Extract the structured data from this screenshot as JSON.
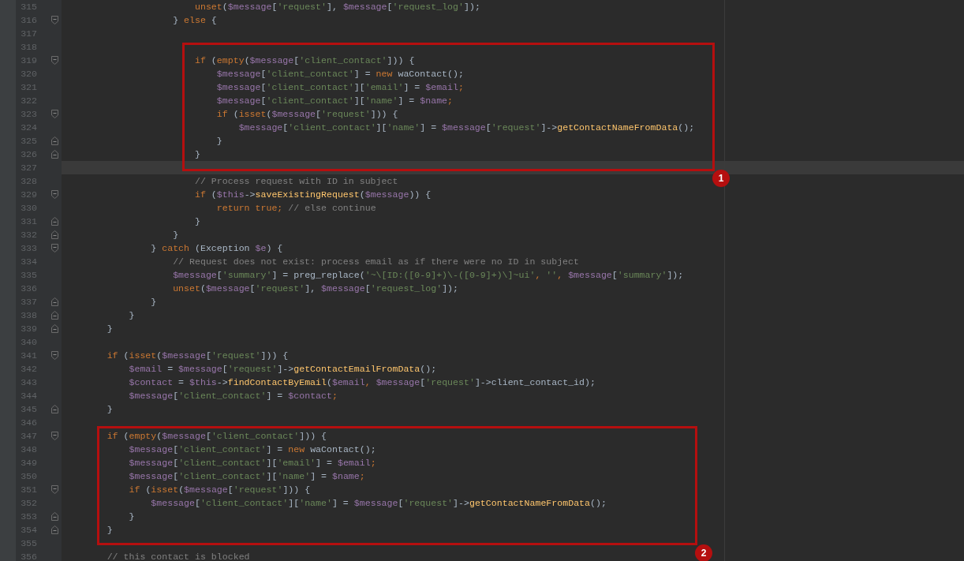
{
  "editor": {
    "lines": [
      {
        "number": "315",
        "fold_start": false,
        "fold_end": false,
        "current": false,
        "tokens": [
          {
            "text": "                        unset",
            "kind": "keyword"
          },
          {
            "text": "(",
            "kind": "plain"
          },
          {
            "text": "$message",
            "kind": "variable"
          },
          {
            "text": "[",
            "kind": "plain"
          },
          {
            "text": "'request'",
            "kind": "string"
          },
          {
            "text": "], ",
            "kind": "plain"
          },
          {
            "text": "$message",
            "kind": "variable"
          },
          {
            "text": "[",
            "kind": "plain"
          },
          {
            "text": "'request_log'",
            "kind": "string"
          },
          {
            "text": "]);",
            "kind": "plain"
          }
        ]
      },
      {
        "number": "316",
        "fold_start": true,
        "fold_end": false,
        "current": false,
        "tokens": [
          {
            "text": "                    } ",
            "kind": "plain"
          },
          {
            "text": "else",
            "kind": "keyword"
          },
          {
            "text": " {",
            "kind": "plain"
          }
        ]
      },
      {
        "number": "317",
        "fold_start": false,
        "fold_end": false,
        "current": false
      },
      {
        "number": "318",
        "fold_start": false,
        "fold_end": false,
        "current": false
      },
      {
        "number": "319",
        "fold_start": true,
        "fold_end": false,
        "current": false,
        "tokens": [
          {
            "text": "                        if ",
            "kind": "keyword"
          },
          {
            "text": "(",
            "kind": "plain"
          },
          {
            "text": "empty",
            "kind": "keyword"
          },
          {
            "text": "(",
            "kind": "plain"
          },
          {
            "text": "$message",
            "kind": "variable"
          },
          {
            "text": "[",
            "kind": "plain"
          },
          {
            "text": "'client_contact'",
            "kind": "string"
          },
          {
            "text": "])) {",
            "kind": "plain"
          }
        ]
      },
      {
        "number": "320",
        "fold_start": false,
        "fold_end": false,
        "current": false,
        "tokens": [
          {
            "text": "                            $message",
            "kind": "variable"
          },
          {
            "text": "[",
            "kind": "plain"
          },
          {
            "text": "'client_contact'",
            "kind": "string"
          },
          {
            "text": "] = ",
            "kind": "plain"
          },
          {
            "text": "new ",
            "kind": "keyword"
          },
          {
            "text": "waContact();",
            "kind": "plain"
          }
        ]
      },
      {
        "number": "321",
        "fold_start": false,
        "fold_end": false,
        "current": false,
        "tokens": [
          {
            "text": "                            $message",
            "kind": "variable"
          },
          {
            "text": "[",
            "kind": "plain"
          },
          {
            "text": "'client_contact'",
            "kind": "string"
          },
          {
            "text": "][",
            "kind": "plain"
          },
          {
            "text": "'email'",
            "kind": "string"
          },
          {
            "text": "] = ",
            "kind": "plain"
          },
          {
            "text": "$email",
            "kind": "variable"
          },
          {
            "text": ";",
            "kind": "keyword"
          }
        ]
      },
      {
        "number": "322",
        "fold_start": false,
        "fold_end": false,
        "current": false,
        "tokens": [
          {
            "text": "                            $message",
            "kind": "variable"
          },
          {
            "text": "[",
            "kind": "plain"
          },
          {
            "text": "'client_contact'",
            "kind": "string"
          },
          {
            "text": "][",
            "kind": "plain"
          },
          {
            "text": "'name'",
            "kind": "string"
          },
          {
            "text": "] = ",
            "kind": "plain"
          },
          {
            "text": "$name",
            "kind": "variable"
          },
          {
            "text": ";",
            "kind": "keyword"
          }
        ]
      },
      {
        "number": "323",
        "fold_start": true,
        "fold_end": false,
        "current": false,
        "tokens": [
          {
            "text": "                            if ",
            "kind": "keyword"
          },
          {
            "text": "(",
            "kind": "plain"
          },
          {
            "text": "isset",
            "kind": "keyword"
          },
          {
            "text": "(",
            "kind": "plain"
          },
          {
            "text": "$message",
            "kind": "variable"
          },
          {
            "text": "[",
            "kind": "plain"
          },
          {
            "text": "'request'",
            "kind": "string"
          },
          {
            "text": "])) {",
            "kind": "plain"
          }
        ]
      },
      {
        "number": "324",
        "fold_start": false,
        "fold_end": false,
        "current": false,
        "tokens": [
          {
            "text": "                                $message",
            "kind": "variable"
          },
          {
            "text": "[",
            "kind": "plain"
          },
          {
            "text": "'client_contact'",
            "kind": "string"
          },
          {
            "text": "][",
            "kind": "plain"
          },
          {
            "text": "'name'",
            "kind": "string"
          },
          {
            "text": "] = ",
            "kind": "plain"
          },
          {
            "text": "$message",
            "kind": "variable"
          },
          {
            "text": "[",
            "kind": "plain"
          },
          {
            "text": "'request'",
            "kind": "string"
          },
          {
            "text": "]->",
            "kind": "plain"
          },
          {
            "text": "getContactNameFromData",
            "kind": "function"
          },
          {
            "text": "();",
            "kind": "plain"
          }
        ]
      },
      {
        "number": "325",
        "fold_start": false,
        "fold_end": true,
        "current": false,
        "tokens": [
          {
            "text": "                            }",
            "kind": "plain"
          }
        ]
      },
      {
        "number": "326",
        "fold_start": false,
        "fold_end": true,
        "current": false,
        "tokens": [
          {
            "text": "                        }",
            "kind": "plain"
          }
        ]
      },
      {
        "number": "327",
        "fold_start": false,
        "fold_end": false,
        "current": true
      },
      {
        "number": "328",
        "fold_start": false,
        "fold_end": false,
        "current": false,
        "tokens": [
          {
            "text": "                        // Process request with ID in subject",
            "kind": "comment"
          }
        ]
      },
      {
        "number": "329",
        "fold_start": true,
        "fold_end": false,
        "current": false,
        "tokens": [
          {
            "text": "                        if ",
            "kind": "keyword"
          },
          {
            "text": "(",
            "kind": "plain"
          },
          {
            "text": "$this",
            "kind": "variable"
          },
          {
            "text": "->",
            "kind": "plain"
          },
          {
            "text": "saveExistingRequest",
            "kind": "function"
          },
          {
            "text": "(",
            "kind": "plain"
          },
          {
            "text": "$message",
            "kind": "variable"
          },
          {
            "text": ")) {",
            "kind": "plain"
          }
        ]
      },
      {
        "number": "330",
        "fold_start": false,
        "fold_end": false,
        "current": false,
        "tokens": [
          {
            "text": "                            return true; ",
            "kind": "keyword"
          },
          {
            "text": "// else continue",
            "kind": "comment"
          }
        ]
      },
      {
        "number": "331",
        "fold_start": false,
        "fold_end": true,
        "current": false,
        "tokens": [
          {
            "text": "                        }",
            "kind": "plain"
          }
        ]
      },
      {
        "number": "332",
        "fold_start": false,
        "fold_end": true,
        "current": false,
        "tokens": [
          {
            "text": "                    }",
            "kind": "plain"
          }
        ]
      },
      {
        "number": "333",
        "fold_start": true,
        "fold_end": false,
        "current": false,
        "tokens": [
          {
            "text": "                } ",
            "kind": "plain"
          },
          {
            "text": "catch ",
            "kind": "keyword"
          },
          {
            "text": "(Exception ",
            "kind": "plain"
          },
          {
            "text": "$e",
            "kind": "variable"
          },
          {
            "text": ") {",
            "kind": "plain"
          }
        ]
      },
      {
        "number": "334",
        "fold_start": false,
        "fold_end": false,
        "current": false,
        "tokens": [
          {
            "text": "                    // Request does not exist: process email as if there were no ID in subject",
            "kind": "comment"
          }
        ]
      },
      {
        "number": "335",
        "fold_start": false,
        "fold_end": false,
        "current": false,
        "tokens": [
          {
            "text": "                    $message",
            "kind": "variable"
          },
          {
            "text": "[",
            "kind": "plain"
          },
          {
            "text": "'summary'",
            "kind": "string"
          },
          {
            "text": "] = preg_replace(",
            "kind": "plain"
          },
          {
            "text": "'~\\[ID:([0-9]+)\\-([0-9]+)\\]~ui'",
            "kind": "string"
          },
          {
            "text": ", ",
            "kind": "keyword"
          },
          {
            "text": "''",
            "kind": "string"
          },
          {
            "text": ", ",
            "kind": "keyword"
          },
          {
            "text": "$message",
            "kind": "variable"
          },
          {
            "text": "[",
            "kind": "plain"
          },
          {
            "text": "'summary'",
            "kind": "string"
          },
          {
            "text": "]);",
            "kind": "plain"
          }
        ]
      },
      {
        "number": "336",
        "fold_start": false,
        "fold_end": false,
        "current": false,
        "tokens": [
          {
            "text": "                    unset",
            "kind": "keyword"
          },
          {
            "text": "(",
            "kind": "plain"
          },
          {
            "text": "$message",
            "kind": "variable"
          },
          {
            "text": "[",
            "kind": "plain"
          },
          {
            "text": "'request'",
            "kind": "string"
          },
          {
            "text": "], ",
            "kind": "plain"
          },
          {
            "text": "$message",
            "kind": "variable"
          },
          {
            "text": "[",
            "kind": "plain"
          },
          {
            "text": "'request_log'",
            "kind": "string"
          },
          {
            "text": "]);",
            "kind": "plain"
          }
        ]
      },
      {
        "number": "337",
        "fold_start": false,
        "fold_end": true,
        "current": false,
        "tokens": [
          {
            "text": "                }",
            "kind": "plain"
          }
        ]
      },
      {
        "number": "338",
        "fold_start": false,
        "fold_end": true,
        "current": false,
        "tokens": [
          {
            "text": "            }",
            "kind": "plain"
          }
        ]
      },
      {
        "number": "339",
        "fold_start": false,
        "fold_end": true,
        "current": false,
        "tokens": [
          {
            "text": "        }",
            "kind": "plain"
          }
        ]
      },
      {
        "number": "340",
        "fold_start": false,
        "fold_end": false,
        "current": false
      },
      {
        "number": "341",
        "fold_start": true,
        "fold_end": false,
        "current": false,
        "tokens": [
          {
            "text": "        if ",
            "kind": "keyword"
          },
          {
            "text": "(",
            "kind": "plain"
          },
          {
            "text": "isset",
            "kind": "keyword"
          },
          {
            "text": "(",
            "kind": "plain"
          },
          {
            "text": "$message",
            "kind": "variable"
          },
          {
            "text": "[",
            "kind": "plain"
          },
          {
            "text": "'request'",
            "kind": "string"
          },
          {
            "text": "])) {",
            "kind": "plain"
          }
        ]
      },
      {
        "number": "342",
        "fold_start": false,
        "fold_end": false,
        "current": false,
        "tokens": [
          {
            "text": "            $email",
            "kind": "variable"
          },
          {
            "text": " = ",
            "kind": "plain"
          },
          {
            "text": "$message",
            "kind": "variable"
          },
          {
            "text": "[",
            "kind": "plain"
          },
          {
            "text": "'request'",
            "kind": "string"
          },
          {
            "text": "]->",
            "kind": "plain"
          },
          {
            "text": "getContactEmailFromData",
            "kind": "function"
          },
          {
            "text": "();",
            "kind": "plain"
          }
        ]
      },
      {
        "number": "343",
        "fold_start": false,
        "fold_end": false,
        "current": false,
        "tokens": [
          {
            "text": "            $contact",
            "kind": "variable"
          },
          {
            "text": " = ",
            "kind": "plain"
          },
          {
            "text": "$this",
            "kind": "variable"
          },
          {
            "text": "->",
            "kind": "plain"
          },
          {
            "text": "findContactByEmail",
            "kind": "function"
          },
          {
            "text": "(",
            "kind": "plain"
          },
          {
            "text": "$email",
            "kind": "variable"
          },
          {
            "text": ", ",
            "kind": "keyword"
          },
          {
            "text": "$message",
            "kind": "variable"
          },
          {
            "text": "[",
            "kind": "plain"
          },
          {
            "text": "'request'",
            "kind": "string"
          },
          {
            "text": "]->client_contact_id);",
            "kind": "plain"
          }
        ]
      },
      {
        "number": "344",
        "fold_start": false,
        "fold_end": false,
        "current": false,
        "tokens": [
          {
            "text": "            $message",
            "kind": "variable"
          },
          {
            "text": "[",
            "kind": "plain"
          },
          {
            "text": "'client_contact'",
            "kind": "string"
          },
          {
            "text": "] = ",
            "kind": "plain"
          },
          {
            "text": "$contact",
            "kind": "variable"
          },
          {
            "text": ";",
            "kind": "keyword"
          }
        ]
      },
      {
        "number": "345",
        "fold_start": false,
        "fold_end": true,
        "current": false,
        "tokens": [
          {
            "text": "        }",
            "kind": "plain"
          }
        ]
      },
      {
        "number": "346",
        "fold_start": false,
        "fold_end": false,
        "current": false
      },
      {
        "number": "347",
        "fold_start": true,
        "fold_end": false,
        "current": false,
        "tokens": [
          {
            "text": "        if ",
            "kind": "keyword"
          },
          {
            "text": "(",
            "kind": "plain"
          },
          {
            "text": "empty",
            "kind": "keyword"
          },
          {
            "text": "(",
            "kind": "plain"
          },
          {
            "text": "$message",
            "kind": "variable"
          },
          {
            "text": "[",
            "kind": "plain"
          },
          {
            "text": "'client_contact'",
            "kind": "string"
          },
          {
            "text": "])) {",
            "kind": "plain"
          }
        ]
      },
      {
        "number": "348",
        "fold_start": false,
        "fold_end": false,
        "current": false,
        "tokens": [
          {
            "text": "            $message",
            "kind": "variable"
          },
          {
            "text": "[",
            "kind": "plain"
          },
          {
            "text": "'client_contact'",
            "kind": "string"
          },
          {
            "text": "] = ",
            "kind": "plain"
          },
          {
            "text": "new ",
            "kind": "keyword"
          },
          {
            "text": "waContact();",
            "kind": "plain"
          }
        ]
      },
      {
        "number": "349",
        "fold_start": false,
        "fold_end": false,
        "current": false,
        "tokens": [
          {
            "text": "            $message",
            "kind": "variable"
          },
          {
            "text": "[",
            "kind": "plain"
          },
          {
            "text": "'client_contact'",
            "kind": "string"
          },
          {
            "text": "][",
            "kind": "plain"
          },
          {
            "text": "'email'",
            "kind": "string"
          },
          {
            "text": "] = ",
            "kind": "plain"
          },
          {
            "text": "$email",
            "kind": "variable"
          },
          {
            "text": ";",
            "kind": "keyword"
          }
        ]
      },
      {
        "number": "350",
        "fold_start": false,
        "fold_end": false,
        "current": false,
        "tokens": [
          {
            "text": "            $message",
            "kind": "variable"
          },
          {
            "text": "[",
            "kind": "plain"
          },
          {
            "text": "'client_contact'",
            "kind": "string"
          },
          {
            "text": "][",
            "kind": "plain"
          },
          {
            "text": "'name'",
            "kind": "string"
          },
          {
            "text": "] = ",
            "kind": "plain"
          },
          {
            "text": "$name",
            "kind": "variable"
          },
          {
            "text": ";",
            "kind": "keyword"
          }
        ]
      },
      {
        "number": "351",
        "fold_start": true,
        "fold_end": false,
        "current": false,
        "tokens": [
          {
            "text": "            if ",
            "kind": "keyword"
          },
          {
            "text": "(",
            "kind": "plain"
          },
          {
            "text": "isset",
            "kind": "keyword"
          },
          {
            "text": "(",
            "kind": "plain"
          },
          {
            "text": "$message",
            "kind": "variable"
          },
          {
            "text": "[",
            "kind": "plain"
          },
          {
            "text": "'request'",
            "kind": "string"
          },
          {
            "text": "])) {",
            "kind": "plain"
          }
        ]
      },
      {
        "number": "352",
        "fold_start": false,
        "fold_end": false,
        "current": false,
        "tokens": [
          {
            "text": "                $message",
            "kind": "variable"
          },
          {
            "text": "[",
            "kind": "plain"
          },
          {
            "text": "'client_contact'",
            "kind": "string"
          },
          {
            "text": "][",
            "kind": "plain"
          },
          {
            "text": "'name'",
            "kind": "string"
          },
          {
            "text": "] = ",
            "kind": "plain"
          },
          {
            "text": "$message",
            "kind": "variable"
          },
          {
            "text": "[",
            "kind": "plain"
          },
          {
            "text": "'request'",
            "kind": "string"
          },
          {
            "text": "]->",
            "kind": "plain"
          },
          {
            "text": "getContactNameFromData",
            "kind": "function"
          },
          {
            "text": "();",
            "kind": "plain"
          }
        ]
      },
      {
        "number": "353",
        "fold_start": false,
        "fold_end": true,
        "current": false,
        "tokens": [
          {
            "text": "            }",
            "kind": "plain"
          }
        ]
      },
      {
        "number": "354",
        "fold_start": false,
        "fold_end": true,
        "current": false,
        "tokens": [
          {
            "text": "        }",
            "kind": "plain"
          }
        ]
      },
      {
        "number": "355",
        "fold_start": false,
        "fold_end": false,
        "current": false
      },
      {
        "number": "356",
        "fold_start": false,
        "fold_end": false,
        "current": false,
        "tokens": [
          {
            "text": "        // this contact is blocked",
            "kind": "comment"
          }
        ]
      }
    ]
  },
  "annotations": [
    {
      "label": "1"
    },
    {
      "label": "2"
    }
  ]
}
